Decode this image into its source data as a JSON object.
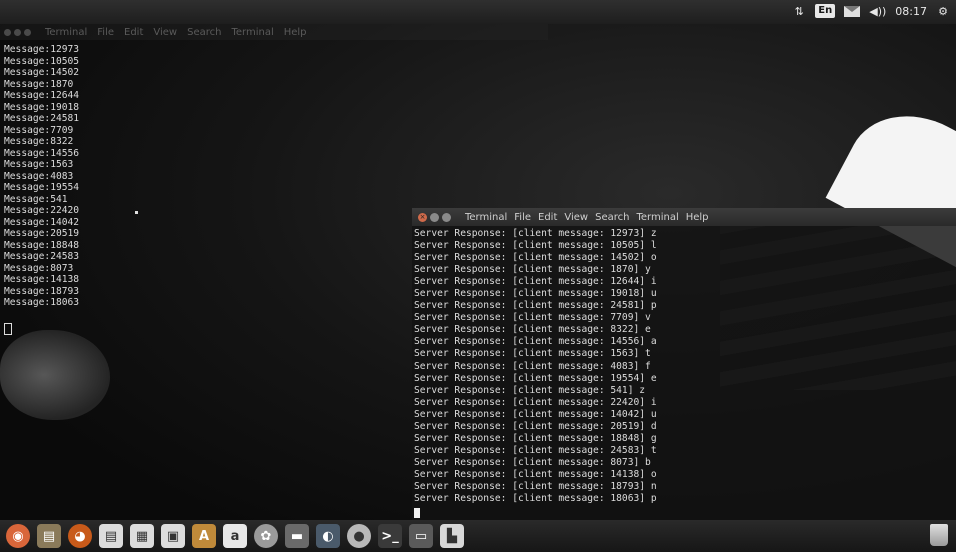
{
  "top_panel": {
    "network_icon": "arrows-updown-icon",
    "keyboard_layout": "En",
    "mail_icon": "envelope-icon",
    "volume_label": "◀))",
    "clock": "08:17",
    "gear_icon": "gear-icon"
  },
  "client_terminal": {
    "menu_items": [
      "Terminal",
      "File",
      "Edit",
      "View",
      "Search",
      "Terminal",
      "Help"
    ],
    "lines": [
      "Message:12973",
      "Message:10505",
      "Message:14502",
      "Message:1870",
      "Message:12644",
      "Message:19018",
      "Message:24581",
      "Message:7709",
      "Message:8322",
      "Message:14556",
      "Message:1563",
      "Message:4083",
      "Message:19554",
      "Message:541",
      "Message:22420",
      "Message:14042",
      "Message:20519",
      "Message:18848",
      "Message:24583",
      "Message:8073",
      "Message:14138",
      "Message:18793",
      "Message:18063"
    ]
  },
  "server_terminal": {
    "window_buttons": [
      "close",
      "minimize",
      "maximize"
    ],
    "menu_items": [
      "Terminal",
      "File",
      "Edit",
      "View",
      "Search",
      "Terminal",
      "Help"
    ],
    "lines": [
      "Server Response: [client message: 12973] z",
      "Server Response: [client message: 10505] l",
      "Server Response: [client message: 14502] o",
      "Server Response: [client message: 1870] y",
      "Server Response: [client message: 12644] i",
      "Server Response: [client message: 19018] u",
      "Server Response: [client message: 24581] p",
      "Server Response: [client message: 7709] v",
      "Server Response: [client message: 8322] e",
      "Server Response: [client message: 14556] a",
      "Server Response: [client message: 1563] t",
      "Server Response: [client message: 4083] f",
      "Server Response: [client message: 19554] e",
      "Server Response: [client message: 541] z",
      "Server Response: [client message: 22420] i",
      "Server Response: [client message: 14042] u",
      "Server Response: [client message: 20519] d",
      "Server Response: [client message: 18848] g",
      "Server Response: [client message: 24583] t",
      "Server Response: [client message: 8073] b",
      "Server Response: [client message: 14138] o",
      "Server Response: [client message: 18793] n",
      "Server Response: [client message: 18063] p"
    ]
  },
  "dock": {
    "items": [
      {
        "name": "dash-home-icon",
        "glyph": "◉",
        "color": "#d9663a",
        "round": true
      },
      {
        "name": "files-icon",
        "glyph": "▤",
        "color": "#8a7a5a"
      },
      {
        "name": "firefox-icon",
        "glyph": "◕",
        "color": "#c85a1a",
        "round": true
      },
      {
        "name": "writer-icon",
        "glyph": "▤",
        "color": "#dcdcdc"
      },
      {
        "name": "calc-icon",
        "glyph": "▦",
        "color": "#dcdcdc"
      },
      {
        "name": "impress-icon",
        "glyph": "▣",
        "color": "#dcdcdc"
      },
      {
        "name": "software-center-icon",
        "glyph": "A",
        "color": "#c08a3a"
      },
      {
        "name": "amazon-icon",
        "glyph": "a",
        "color": "#e8e8e8"
      },
      {
        "name": "settings-icon",
        "glyph": "✿",
        "color": "#9a9a9a",
        "round": true
      },
      {
        "name": "workspace-icon",
        "glyph": "▬",
        "color": "#6a6a6a"
      },
      {
        "name": "app-icon",
        "glyph": "◐",
        "color": "#4a5a6a"
      },
      {
        "name": "circle-app-icon",
        "glyph": "●",
        "color": "#b8b8b8",
        "round": true
      },
      {
        "name": "terminal-icon",
        "glyph": ">_",
        "color": "#3a3a3a"
      },
      {
        "name": "window-icon",
        "glyph": "▭",
        "color": "#5a5a5a"
      },
      {
        "name": "drive-icon",
        "glyph": "▙",
        "color": "#d8d8d8"
      }
    ],
    "trash_icon": "trash-icon"
  }
}
